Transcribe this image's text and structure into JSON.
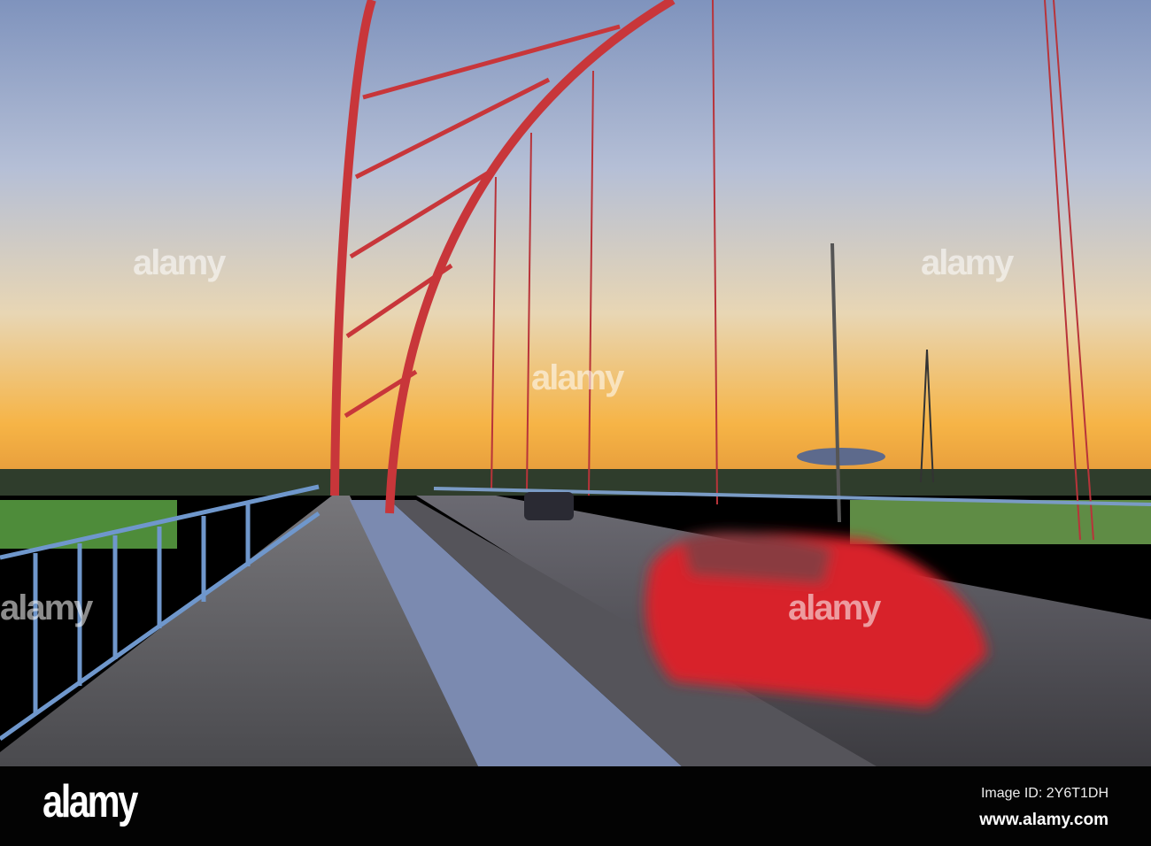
{
  "photo": {
    "subject": "bridge",
    "watermark": "alamy"
  },
  "colors": {
    "arch": "#c8363a",
    "railing": "#6f97cc",
    "car": "#d8222a",
    "sky_top": "#8aa0c6",
    "horizon": "#f5b23f"
  },
  "footer": {
    "logo": "alamy",
    "image_id": "Image ID: 2Y6T1DH",
    "website": "www.alamy.com"
  }
}
